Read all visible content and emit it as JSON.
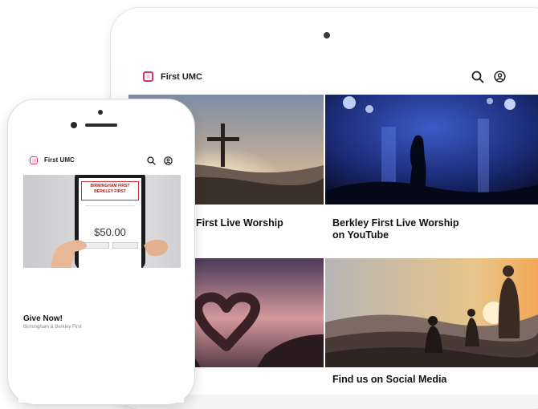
{
  "tablet": {
    "app_bar": {
      "brand": "First UMC",
      "search_icon": "search-icon",
      "account_icon": "account-circle-icon"
    },
    "tiles": [
      {
        "title": "First Live Worship"
      },
      {
        "title_line1": "Berkley First Live Worship",
        "title_line2": "on YouTube"
      },
      {
        "title": ""
      },
      {
        "title": "Find us on Social Media"
      }
    ]
  },
  "phone": {
    "app_bar": {
      "brand": "First UMC"
    },
    "give": {
      "title": "Give Now!",
      "subtitle": "Birmingham & Berkley First",
      "device_header_line1": "BIRMINGHAM FIRST",
      "device_header_line2": "BERKLEY FIRST",
      "device_amount": "$50.00"
    }
  },
  "colors": {
    "brand_accent": "#d6316f",
    "text": "#111111"
  }
}
